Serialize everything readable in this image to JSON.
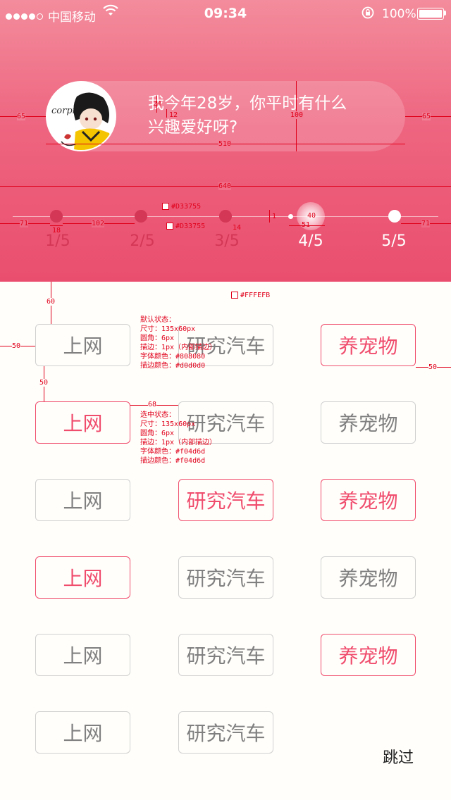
{
  "status_bar": {
    "carrier": "中国移动",
    "time": "09:34",
    "battery": "100%"
  },
  "question": {
    "line1": "我今年28岁，你平时有什么",
    "line2": "兴趣爱好呀?"
  },
  "progress": {
    "current_step": 4,
    "total_steps": 5,
    "steps": [
      "1/5",
      "2/5",
      "3/5",
      "4/5",
      "5/5"
    ]
  },
  "tags": [
    [
      {
        "label": "上网",
        "selected": false
      },
      {
        "label": "研究汽车",
        "selected": false
      },
      {
        "label": "养宠物",
        "selected": true
      }
    ],
    [
      {
        "label": "上网",
        "selected": true
      },
      {
        "label": "研究汽车",
        "selected": false
      },
      {
        "label": "养宠物",
        "selected": false
      }
    ],
    [
      {
        "label": "上网",
        "selected": false
      },
      {
        "label": "研究汽车",
        "selected": true
      },
      {
        "label": "养宠物",
        "selected": true
      }
    ],
    [
      {
        "label": "上网",
        "selected": true
      },
      {
        "label": "研究汽车",
        "selected": false
      },
      {
        "label": "养宠物",
        "selected": false
      }
    ],
    [
      {
        "label": "上网",
        "selected": false
      },
      {
        "label": "研究汽车",
        "selected": false
      },
      {
        "label": "养宠物",
        "selected": true
      }
    ],
    [
      {
        "label": "上网",
        "selected": false
      },
      {
        "label": "研究汽车",
        "selected": false
      }
    ]
  ],
  "skip_label": "跳过",
  "annotations": {
    "measure": {
      "m65": "65",
      "m24": "24",
      "m12": "12",
      "m100": "100",
      "m510": "510",
      "m640": "640",
      "m71": "71",
      "m18": "18",
      "m102": "102",
      "m1": "1",
      "m40": "40",
      "m51": "51",
      "m14": "14",
      "m60": "60",
      "m50": "50",
      "m68": "68"
    },
    "color_d33755": "#D33755",
    "color_fffefb": "#FFFEFB",
    "default_state": [
      "默认状态：",
      "尺寸：135x60px",
      "圆角：6px",
      "描边：1px（内部描边）",
      "字体颜色：#808080",
      "描边颜色：#d0d0d0"
    ],
    "selected_state": [
      "选中状态：",
      "尺寸：135x60px",
      "圆角：6px",
      "描边：1px（内部描边）",
      "字体颜色：#f04d6d",
      "描边颜色：#f04d6d"
    ]
  },
  "colors": {
    "header_top": "#F38C9C",
    "header_bottom": "#EA4E6E",
    "background": "#FFFEFB",
    "step_done": "#D33755",
    "tag_default_text": "#808080",
    "tag_default_border": "#d0d0d0",
    "tag_selected": "#f04d6d"
  },
  "icons": [
    "signal-dots-icon",
    "wifi-icon",
    "orientation-lock-icon",
    "battery-icon",
    "avatar-image"
  ]
}
